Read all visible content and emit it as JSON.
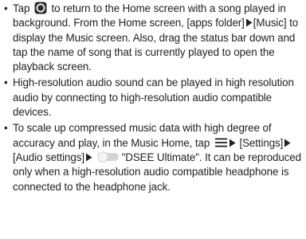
{
  "bullet_mark": "•",
  "icons": {
    "home": "home-button-icon",
    "arrow": "right-triangle-arrow-icon",
    "menu": "menu-lines-icon",
    "toggle": "toggle-switch-off-icon"
  },
  "colors": {
    "text": "#222222",
    "icon_dark": "#2b2b2b",
    "toggle_track": "#d4d4d4",
    "toggle_knob": "#f4f4f4"
  },
  "bullets": [
    {
      "a": "Tap",
      "b": "to return to the Home screen with a song played in background. From the Home screen, [apps folder]",
      "c": "[Music] to display the Music screen. Also, drag the status bar down and tap the name of song that is currently played to open the playback screen."
    },
    {
      "text": "High-resolution audio sound can be played in high resolution audio by connecting to high-resolution audio compatible devices."
    },
    {
      "a": "To scale up compressed music data with high degree of accuracy and play, in the Music Home, tap",
      "b": "[Settings]",
      "c": "[Audio settings]",
      "d": "\"DSEE Ultimate\". It can be reproduced only when a high-resolution audio compatible headphone is connected to the headphone jack."
    }
  ]
}
